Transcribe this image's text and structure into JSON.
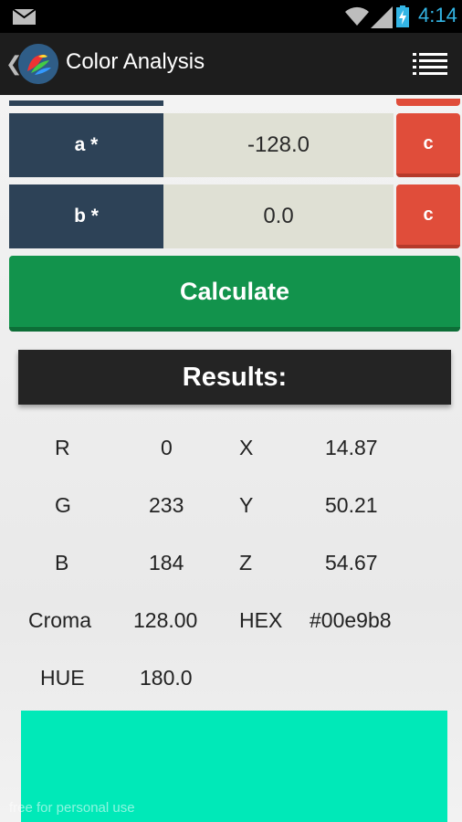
{
  "status_bar": {
    "time": "4:14",
    "icons": [
      "mail-icon",
      "wifi-icon",
      "signal-icon",
      "battery-charging-icon"
    ]
  },
  "action_bar": {
    "title": "Color Analysis",
    "back_icon": "chevron-left-icon",
    "menu_icon": "list-menu-icon"
  },
  "inputs": [
    {
      "label": "a *",
      "value": "-128.0",
      "clear_label": "c"
    },
    {
      "label": "b *",
      "value": "0.0",
      "clear_label": "c"
    }
  ],
  "calculate_label": "Calculate",
  "results": {
    "title": "Results:",
    "rows": [
      {
        "k1": "R",
        "v1": "0",
        "k2": "X",
        "v2": "14.87"
      },
      {
        "k1": "G",
        "v1": "233",
        "k2": "Y",
        "v2": "50.21"
      },
      {
        "k1": "B",
        "v1": "184",
        "k2": "Z",
        "v2": "54.67"
      },
      {
        "k1": "Croma",
        "v1": "128.00",
        "k2": "HEX",
        "v2": "#00e9b8"
      },
      {
        "k1": "HUE",
        "v1": "180.0"
      }
    ]
  },
  "swatch_color": "#00e9b8",
  "colors": {
    "label_bg": "#2d4257",
    "clear_bg": "#e04d3a",
    "calc_bg": "#12934c",
    "accent": "#33b5e5"
  },
  "watermark": "free for personal use"
}
